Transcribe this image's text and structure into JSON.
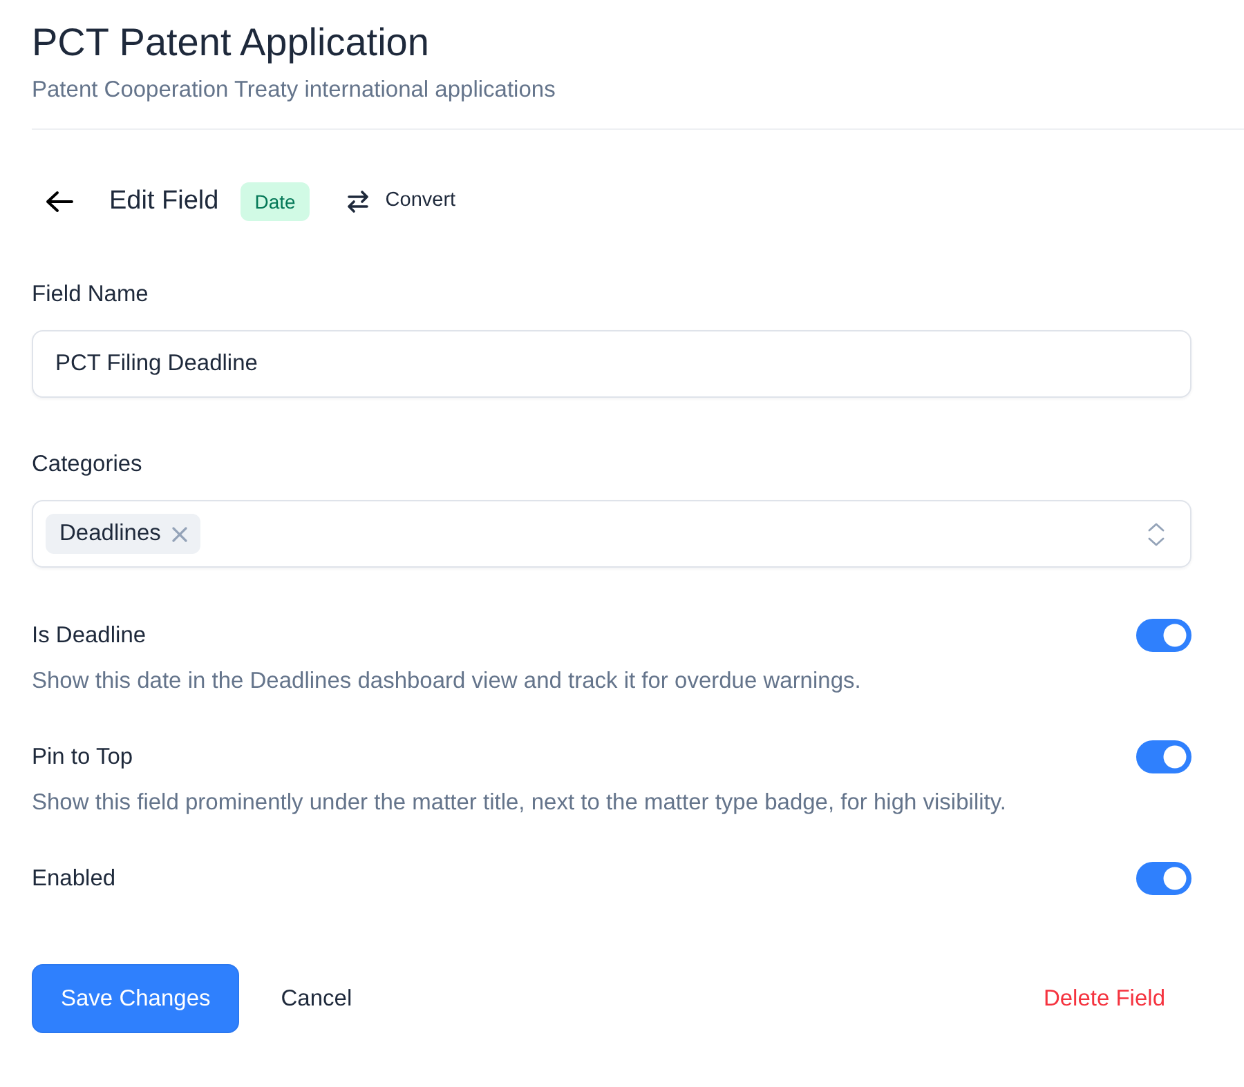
{
  "header": {
    "title": "PCT Patent Application",
    "subtitle": "Patent Cooperation Treaty international applications"
  },
  "toolbar": {
    "title": "Edit Field",
    "type_badge": "Date",
    "convert_label": "Convert"
  },
  "fields": [
    {
      "kind": "text",
      "label": "Field Name",
      "value": "PCT Filing Deadline"
    },
    {
      "kind": "multiselect",
      "label": "Categories",
      "tags": [
        "Deadlines"
      ]
    }
  ],
  "toggles": [
    {
      "label": "Is Deadline",
      "description": "Show this date in the Deadlines dashboard view and track it for overdue warnings.",
      "on": true
    },
    {
      "label": "Pin to Top",
      "description": "Show this field prominently under the matter title, next to the matter type badge, for high visibility.",
      "on": true
    },
    {
      "label": "Enabled",
      "on": true
    }
  ],
  "actions": {
    "save": "Save Changes",
    "cancel": "Cancel",
    "delete": "Delete Field"
  }
}
